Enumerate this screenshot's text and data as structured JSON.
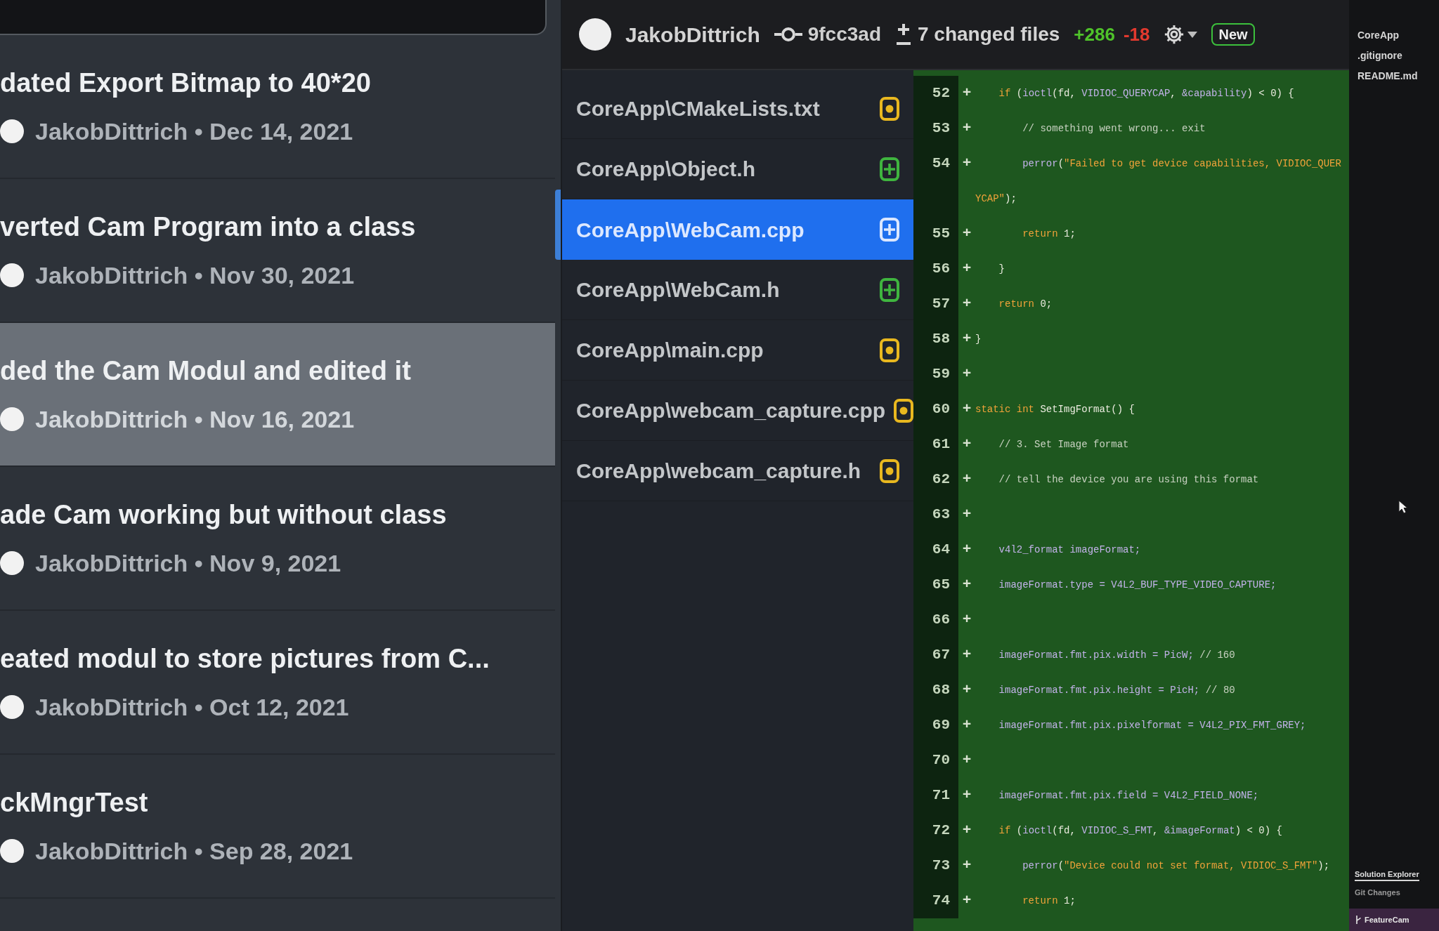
{
  "commits": [
    {
      "title": "dated Export Bitmap to 40*20",
      "meta": "JakobDittrich • Dec 14, 2021",
      "selected": false
    },
    {
      "title": "verted Cam Program into a class",
      "meta": "JakobDittrich • Nov 30, 2021",
      "selected": false
    },
    {
      "title": "ded the Cam Modul and edited it",
      "meta": "JakobDittrich • Nov 16, 2021",
      "selected": true
    },
    {
      "title": "ade Cam working but without class",
      "meta": "JakobDittrich • Nov 9, 2021",
      "selected": false
    },
    {
      "title": "eated modul to store pictures from C...",
      "meta": "JakobDittrich • Oct 12, 2021",
      "selected": false
    },
    {
      "title": "ckMngrTest",
      "meta": "JakobDittrich • Sep 28, 2021",
      "selected": false
    }
  ],
  "commit_header": {
    "author": "JakobDittrich",
    "hash": "9fcc3ad",
    "changed_files": "7 changed files",
    "additions": "+286",
    "deletions": "-18",
    "new_button": "New"
  },
  "files": [
    {
      "path": "CoreApp\\CMakeLists.txt",
      "kind": "modified",
      "selected": false
    },
    {
      "path": "CoreApp\\Object.h",
      "kind": "added",
      "selected": false
    },
    {
      "path": "CoreApp\\WebCam.cpp",
      "kind": "added",
      "selected": true
    },
    {
      "path": "CoreApp\\WebCam.h",
      "kind": "added",
      "selected": false
    },
    {
      "path": "CoreApp\\main.cpp",
      "kind": "modified",
      "selected": false
    },
    {
      "path": "CoreApp\\webcam_capture.cpp",
      "kind": "modified",
      "selected": false
    },
    {
      "path": "CoreApp\\webcam_capture.h",
      "kind": "modified",
      "selected": false
    }
  ],
  "diff": {
    "lines": [
      {
        "number": "52",
        "marker": "+",
        "tokens": [
          {
            "kind": "keyword",
            "text": "    if"
          },
          {
            "kind": "plain",
            "text": " ("
          },
          {
            "kind": "ident",
            "text": "ioctl"
          },
          {
            "kind": "plain",
            "text": "(fd, "
          },
          {
            "kind": "ident",
            "text": "VIDIOC_QUERYCAP"
          },
          {
            "kind": "plain",
            "text": ", "
          },
          {
            "kind": "ident",
            "text": "&capability"
          },
          {
            "kind": "plain",
            "text": ") < 0) {"
          }
        ]
      },
      {
        "number": "53",
        "marker": "+",
        "tokens": [
          {
            "kind": "comment",
            "text": "        // something went wrong... exit"
          }
        ]
      },
      {
        "number": "54",
        "marker": "+",
        "tokens": [
          {
            "kind": "ident",
            "text": "        perror"
          },
          {
            "kind": "plain",
            "text": "("
          },
          {
            "kind": "string",
            "text": "\"Failed to get device capabilities, VIDIOC_QUERYCAP\""
          },
          {
            "kind": "plain",
            "text": ");"
          }
        ]
      },
      {
        "number": "55",
        "marker": "+",
        "tokens": [
          {
            "kind": "keyword",
            "text": "        return"
          },
          {
            "kind": "plain",
            "text": " 1;"
          }
        ]
      },
      {
        "number": "56",
        "marker": "+",
        "tokens": [
          {
            "kind": "plain",
            "text": "    }"
          }
        ]
      },
      {
        "number": "57",
        "marker": "+",
        "tokens": [
          {
            "kind": "keyword",
            "text": "    return"
          },
          {
            "kind": "plain",
            "text": " 0;"
          }
        ]
      },
      {
        "number": "58",
        "marker": "+",
        "tokens": [
          {
            "kind": "plain",
            "text": "}"
          }
        ]
      },
      {
        "number": "59",
        "marker": "+"
      },
      {
        "number": "60",
        "marker": "+",
        "tokens": [
          {
            "kind": "keyword",
            "text": "static int"
          },
          {
            "kind": "plain",
            "text": " SetImgFormat() {"
          }
        ]
      },
      {
        "number": "61",
        "marker": "+",
        "tokens": [
          {
            "kind": "comment",
            "text": "    // 3. Set Image format"
          }
        ]
      },
      {
        "number": "62",
        "marker": "+",
        "tokens": [
          {
            "kind": "comment",
            "text": "    // tell the device you are using this format"
          }
        ]
      },
      {
        "number": "63",
        "marker": "+"
      },
      {
        "number": "64",
        "marker": "+",
        "tokens": [
          {
            "kind": "ident",
            "text": "    v4l2_format imageFormat;"
          }
        ]
      },
      {
        "number": "65",
        "marker": "+",
        "tokens": [
          {
            "kind": "ident",
            "text": "    imageFormat.type = V4L2_BUF_TYPE_VIDEO_CAPTURE;"
          }
        ]
      },
      {
        "number": "66",
        "marker": "+"
      },
      {
        "number": "67",
        "marker": "+",
        "tokens": [
          {
            "kind": "ident",
            "text": "    imageFormat.fmt.pix.width = PicW; "
          },
          {
            "kind": "comment",
            "text": "// 160"
          }
        ]
      },
      {
        "number": "68",
        "marker": "+",
        "tokens": [
          {
            "kind": "ident",
            "text": "    imageFormat.fmt.pix.height = PicH; "
          },
          {
            "kind": "comment",
            "text": "// 80"
          }
        ]
      },
      {
        "number": "69",
        "marker": "+",
        "tokens": [
          {
            "kind": "ident",
            "text": "    imageFormat.fmt.pix.pixelformat = V4L2_PIX_FMT_GREY;"
          }
        ]
      },
      {
        "number": "70",
        "marker": "+"
      },
      {
        "number": "71",
        "marker": "+",
        "tokens": [
          {
            "kind": "ident",
            "text": "    imageFormat.fmt.pix.field = V4L2_FIELD_NONE;"
          }
        ]
      },
      {
        "number": "72",
        "marker": "+",
        "tokens": [
          {
            "kind": "keyword",
            "text": "    if"
          },
          {
            "kind": "plain",
            "text": " ("
          },
          {
            "kind": "ident",
            "text": "ioctl"
          },
          {
            "kind": "plain",
            "text": "(fd, "
          },
          {
            "kind": "ident",
            "text": "VIDIOC_S_FMT"
          },
          {
            "kind": "plain",
            "text": ", "
          },
          {
            "kind": "ident",
            "text": "&imageFormat"
          },
          {
            "kind": "plain",
            "text": ") < 0) {"
          }
        ]
      },
      {
        "number": "73",
        "marker": "+",
        "tokens": [
          {
            "kind": "ident",
            "text": "        perror"
          },
          {
            "kind": "plain",
            "text": "("
          },
          {
            "kind": "string",
            "text": "\"Device could not set format, VIDIOC_S_FMT\""
          },
          {
            "kind": "plain",
            "text": ");"
          }
        ]
      },
      {
        "number": "74",
        "marker": "+",
        "tokens": [
          {
            "kind": "keyword",
            "text": "        return"
          },
          {
            "kind": "plain",
            "text": " 1;"
          }
        ]
      }
    ]
  },
  "solution_explorer": {
    "items": [
      {
        "label": "CoreApp"
      },
      {
        "label": ".gitignore"
      },
      {
        "label": "README.md"
      }
    ],
    "tabs": [
      {
        "label": "Solution Explorer",
        "selected": true
      },
      {
        "label": "Git Changes",
        "selected": false
      }
    ],
    "branch": "FeatureCam"
  }
}
